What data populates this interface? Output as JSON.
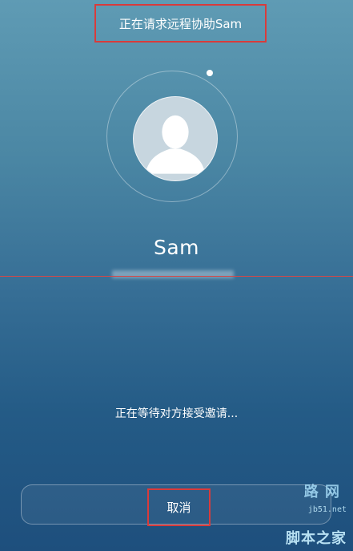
{
  "header": {
    "title": "正在请求远程协助Sam"
  },
  "contact": {
    "name": "Sam",
    "avatar_icon": "person-silhouette-icon"
  },
  "status": {
    "text": "正在等待对方接受邀请..."
  },
  "actions": {
    "cancel_label": "取消"
  },
  "watermark": {
    "top": "路 网",
    "mid": "jb51.net",
    "bottom": "脚本之家"
  },
  "colors": {
    "highlight": "#d93b3b",
    "background_top": "#5f9bb4",
    "background_bottom": "#1e4f7d"
  }
}
